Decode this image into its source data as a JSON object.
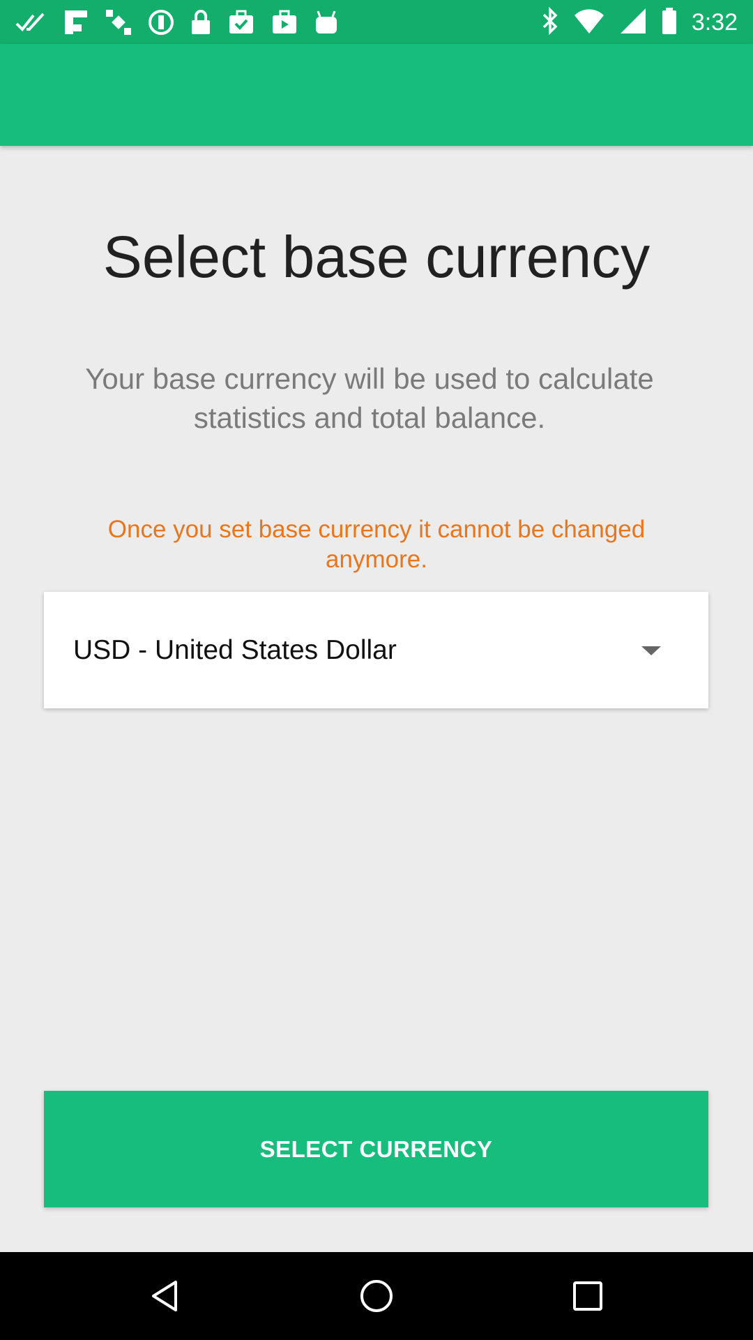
{
  "status_bar": {
    "time": "3:32",
    "left_icons": [
      "double-check-icon",
      "flipboard-icon",
      "satellite-icon",
      "settings-circle-icon",
      "lock-icon",
      "briefcase-check-icon",
      "bag-play-icon",
      "android-icon"
    ],
    "right_icons": [
      "bluetooth-icon"
    ],
    "background": "#13ae6c"
  },
  "app_bar": {
    "background": "#17bd7c"
  },
  "main": {
    "title": "Select base currency",
    "subtitle": "Your base currency will be used to calculate statistics and total balance.",
    "warning": "Once you set base currency it cannot be changed anymore.",
    "warning_color": "#e8761c"
  },
  "currency_select": {
    "selected_value": "USD - United States Dollar"
  },
  "primary_button": {
    "label": "SELECT CURRENCY",
    "background": "#17bd7c"
  },
  "nav_bar": {
    "icons": [
      "back-icon",
      "home-icon",
      "recents-icon"
    ]
  }
}
